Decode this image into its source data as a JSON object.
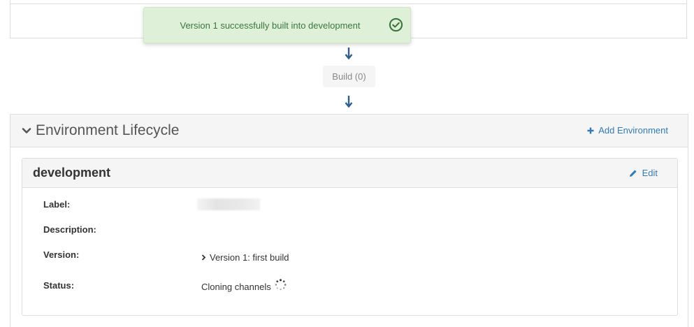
{
  "toast": {
    "message": "Version 1 successfully built into development",
    "icon": "check-circle-icon",
    "color": "#3c763d",
    "background": "#dff0d8"
  },
  "pipeline": {
    "build_label": "Build (0)",
    "arrow_icon": "arrow-down-icon"
  },
  "lifecycle": {
    "title": "Environment Lifecycle",
    "add_label": "Add Environment"
  },
  "environment": {
    "name": "development",
    "edit_label": "Edit",
    "fields": {
      "label_label": "Label:",
      "description_label": "Description:",
      "version_label": "Version:",
      "version_value": "Version 1: first build",
      "status_label": "Status:",
      "status_value": "Cloning channels"
    }
  },
  "colors": {
    "link": "#337ab7",
    "header_bg": "#f5f5f5",
    "border": "#dddddd"
  }
}
